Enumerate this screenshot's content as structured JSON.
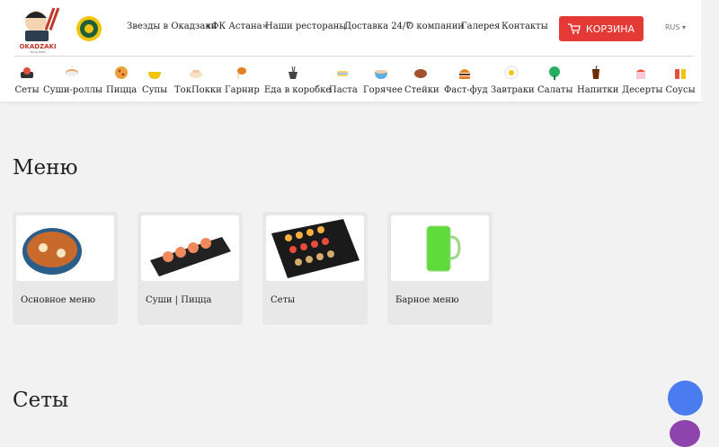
{
  "brand": {
    "logo_text": "OKADZAKI",
    "logo_sub": "Since 2016"
  },
  "topnav": [
    "Звезды в Окадзаки",
    "«ФК Астана»",
    "Наши рестораны",
    "Доставка 24/7",
    "О компании",
    "Галерея",
    "Контакты"
  ],
  "cart": {
    "label": "КОРЗИНА"
  },
  "lang": {
    "label": "RUS"
  },
  "categories": [
    "Сеты",
    "Суши-роллы",
    "Пицца",
    "Супы",
    "ТокПокки",
    "Гарнир",
    "Еда в коробке",
    "Паста",
    "Горячее",
    "Стейки",
    "Фаст-фуд",
    "Завтраки",
    "Салаты",
    "Напитки",
    "Десерты",
    "Соусы"
  ],
  "menu": {
    "title": "Меню",
    "cards": [
      "Основное меню",
      "Суши | Пицца",
      "Сеты",
      "Барное меню"
    ]
  },
  "sets": {
    "title": "Сеты"
  },
  "colors": {
    "accent": "#e53935",
    "fab": "#4a7cf0"
  }
}
